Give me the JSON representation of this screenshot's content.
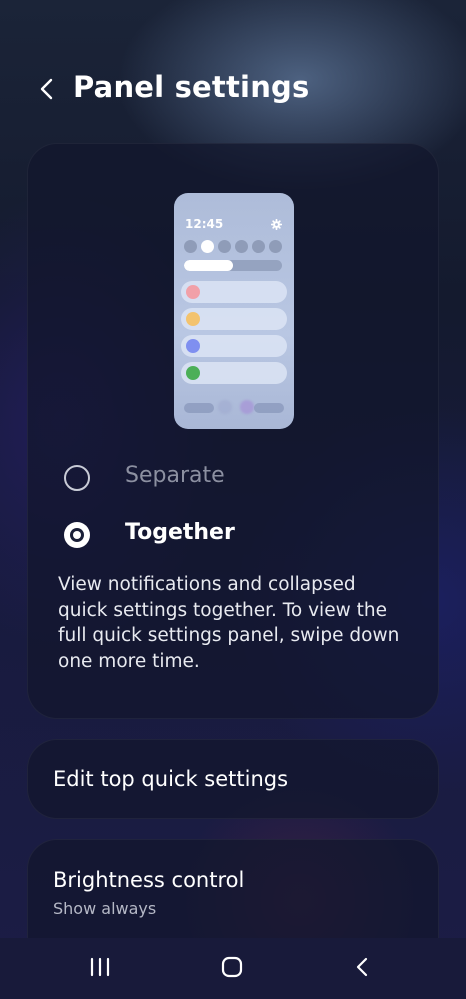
{
  "header": {
    "title": "Panel settings",
    "back_icon": "chevron-left-icon"
  },
  "preview": {
    "time": "12:45",
    "settings_icon": "gear-icon",
    "brightness_level": 0.5,
    "notification_colors": [
      "#f1a0a8",
      "#f3c36e",
      "#7f8ff0",
      "#4caf58"
    ]
  },
  "layout_options": [
    {
      "label": "Separate",
      "selected": false
    },
    {
      "label": "Together",
      "selected": true
    }
  ],
  "description": "View notifications and collapsed quick settings together. To view the full quick settings panel, swipe down one more time.",
  "edit_top_quick_settings": {
    "label": "Edit top quick settings"
  },
  "brightness_control": {
    "label": "Brightness control",
    "value": "Show always"
  },
  "navigation": {
    "recents_icon": "recents-icon",
    "home_icon": "home-icon",
    "back_icon": "back-icon"
  },
  "colors": {
    "accent": "#ffffff",
    "card_background": "#12162d",
    "dim_text": "#8c90a1"
  }
}
